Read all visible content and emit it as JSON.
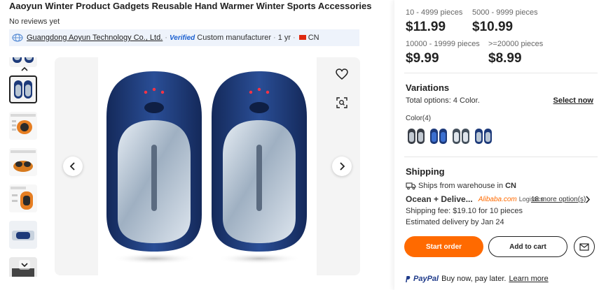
{
  "product": {
    "title": "Aaoyun Winter Product Gadgets Reusable Hand Warmer Winter Sports Accessories",
    "reviews": "No reviews yet"
  },
  "supplier": {
    "name": "Guangdong Aoyun Technology Co., Ltd.",
    "verified": "Verified",
    "type": "Custom manufacturer",
    "years": "1 yr",
    "country": "CN",
    "flag_color": "#de2910"
  },
  "gallery": {
    "thumb_count": 6,
    "selected_thumb": 1
  },
  "pricing": {
    "tiers": [
      {
        "range": "10 - 4999 pieces",
        "price": "$11.99"
      },
      {
        "range": "5000 - 9999 pieces",
        "price": "$10.99"
      },
      {
        "range": "10000 - 19999 pieces",
        "price": "$9.99"
      },
      {
        "range": ">=20000 pieces",
        "price": "$8.99"
      }
    ]
  },
  "variations": {
    "title": "Variations",
    "total": "Total options: 4 Color.",
    "select_label": "Select now",
    "color_label": "Color(4)"
  },
  "shipping": {
    "title": "Shipping",
    "from_prefix": "Ships from warehouse in",
    "from_country": "CN",
    "method": "Ocean + Delive...",
    "carrier_brand": "Alibaba.com",
    "carrier_suffix": "Logistics",
    "more_options": "18 more option(s)",
    "fee": "Shipping fee: $19.10 for 10 pieces",
    "delivery": "Estimated delivery by Jan 24"
  },
  "actions": {
    "start_order": "Start order",
    "add_to_cart": "Add to cart"
  },
  "payment": {
    "logo": "PayPal",
    "text": "Buy now, pay later.",
    "link": "Learn more"
  },
  "colors": {
    "accent": "#ff6a00",
    "device_blue": "#1d3a7a",
    "device_silver": "#b9c6d4"
  }
}
